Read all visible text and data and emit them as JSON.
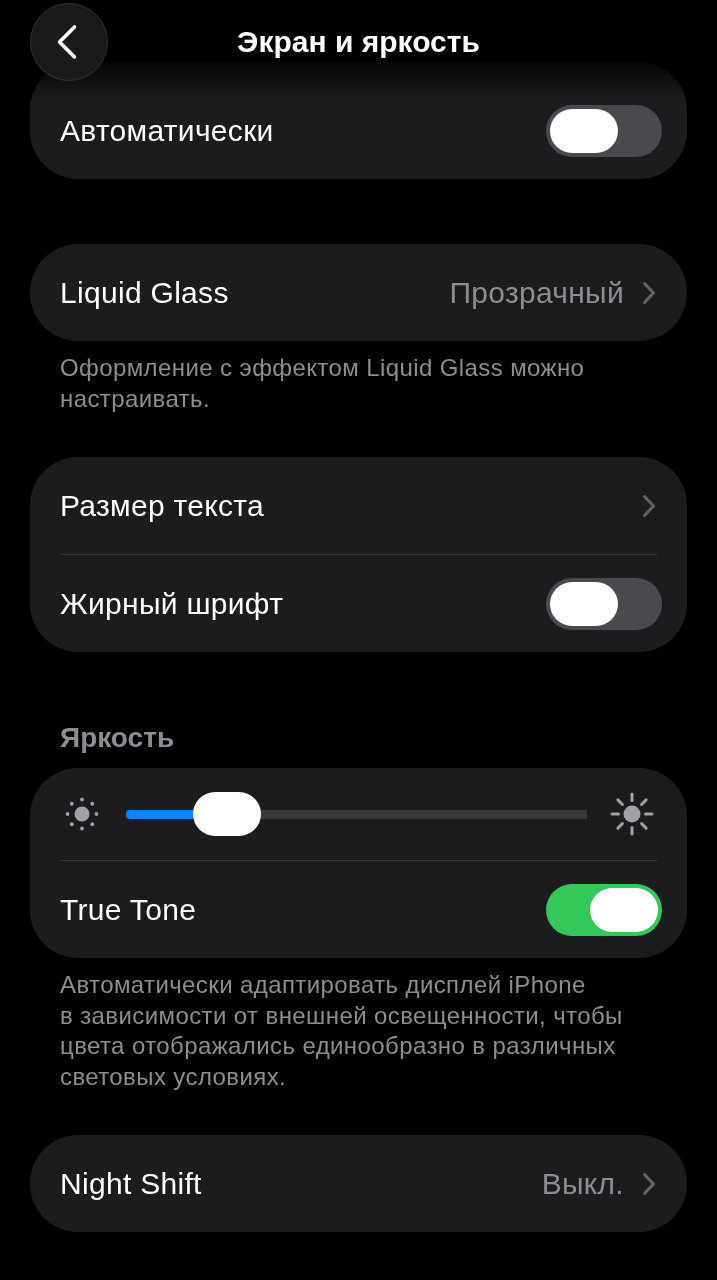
{
  "header": {
    "title": "Экран и яркость"
  },
  "sections": [
    {
      "rows": [
        {
          "kind": "toggle",
          "label": "Автоматически",
          "on": false
        }
      ]
    },
    {
      "rows": [
        {
          "kind": "link",
          "label": "Liquid Glass",
          "value": "Прозрачный"
        }
      ],
      "footer": "Оформление с эффектом Liquid Glass можно настраивать."
    },
    {
      "rows": [
        {
          "kind": "link",
          "label": "Размер текста"
        },
        {
          "kind": "toggle",
          "label": "Жирный шрифт",
          "on": false
        }
      ]
    },
    {
      "header": "Яркость",
      "rows": [
        {
          "kind": "slider",
          "level": 0.17
        },
        {
          "kind": "toggle",
          "label": "True Tone",
          "on": true
        }
      ],
      "footer": "Автоматически адаптировать дисплей iPhone в зависимости от внешней освещенности, чтобы цвета отображались единообразно в различных световых условиях."
    },
    {
      "rows": [
        {
          "kind": "link",
          "label": "Night Shift",
          "value": "Выкл."
        }
      ]
    }
  ]
}
